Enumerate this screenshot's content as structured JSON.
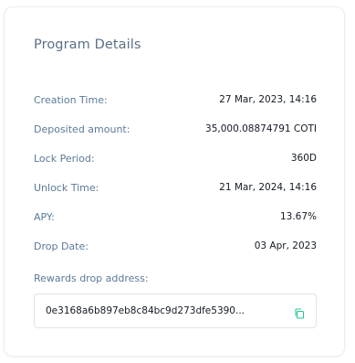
{
  "card": {
    "title": "Program Details",
    "rows": [
      {
        "label": "Creation Time:",
        "value": "27 Mar, 2023, 14:16"
      },
      {
        "label": "Deposited amount:",
        "value": "35,000.08874791 COTI"
      },
      {
        "label": "Lock Period:",
        "value": "360D"
      },
      {
        "label": "Unlock Time:",
        "value": "21 Mar, 2024, 14:16"
      },
      {
        "label": "APY:",
        "value": "13.67%"
      },
      {
        "label": "Drop Date:",
        "value": "03 Apr, 2023"
      }
    ],
    "rewards_address": {
      "label": "Rewards drop address:",
      "value": "0e3168a6b897eb8c84bc9d273dfe5390...",
      "copy_icon": "copy-icon"
    }
  },
  "colors": {
    "accent": "#27c59a",
    "label": "#5b7a97",
    "value": "#141a24",
    "title": "#5a6f86"
  }
}
